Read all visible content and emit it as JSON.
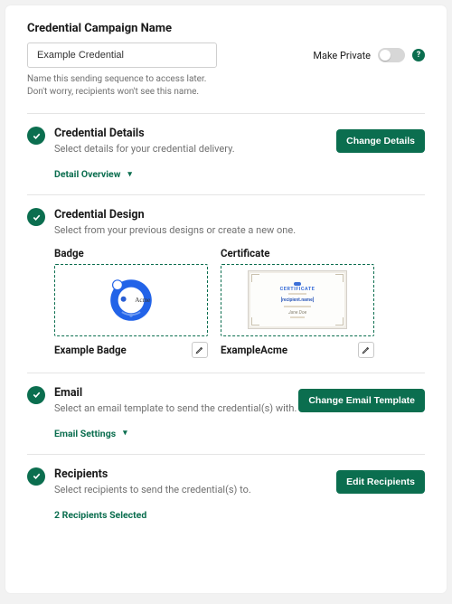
{
  "header": {
    "title": "Credential Campaign Name",
    "input_value": "Example Credential",
    "helper": "Name this sending sequence to access later. Don't worry, recipients won't see this name.",
    "make_private_label": "Make Private",
    "help_char": "?"
  },
  "sections": {
    "details": {
      "title": "Credential Details",
      "subtitle": "Select details for your credential delivery.",
      "button": "Change Details",
      "accordion": "Detail Overview"
    },
    "design": {
      "title": "Credential Design",
      "subtitle": "Select from your previous designs or create a new one.",
      "badge": {
        "type_label": "Badge",
        "name": "Example Badge",
        "brand": "Acme"
      },
      "certificate": {
        "type_label": "Certificate",
        "name": "ExampleAcme",
        "cert_word": "CERTIFICATE",
        "cert_recipient": "[recipient.name]"
      }
    },
    "email": {
      "title": "Email",
      "subtitle": "Select an email template to send the credential(s) with.",
      "button": "Change Email Template",
      "accordion": "Email Settings"
    },
    "recipients": {
      "title": "Recipients",
      "subtitle": "Select recipients to send the credential(s) to.",
      "button": "Edit Recipients",
      "status": "2 Recipients Selected"
    }
  }
}
